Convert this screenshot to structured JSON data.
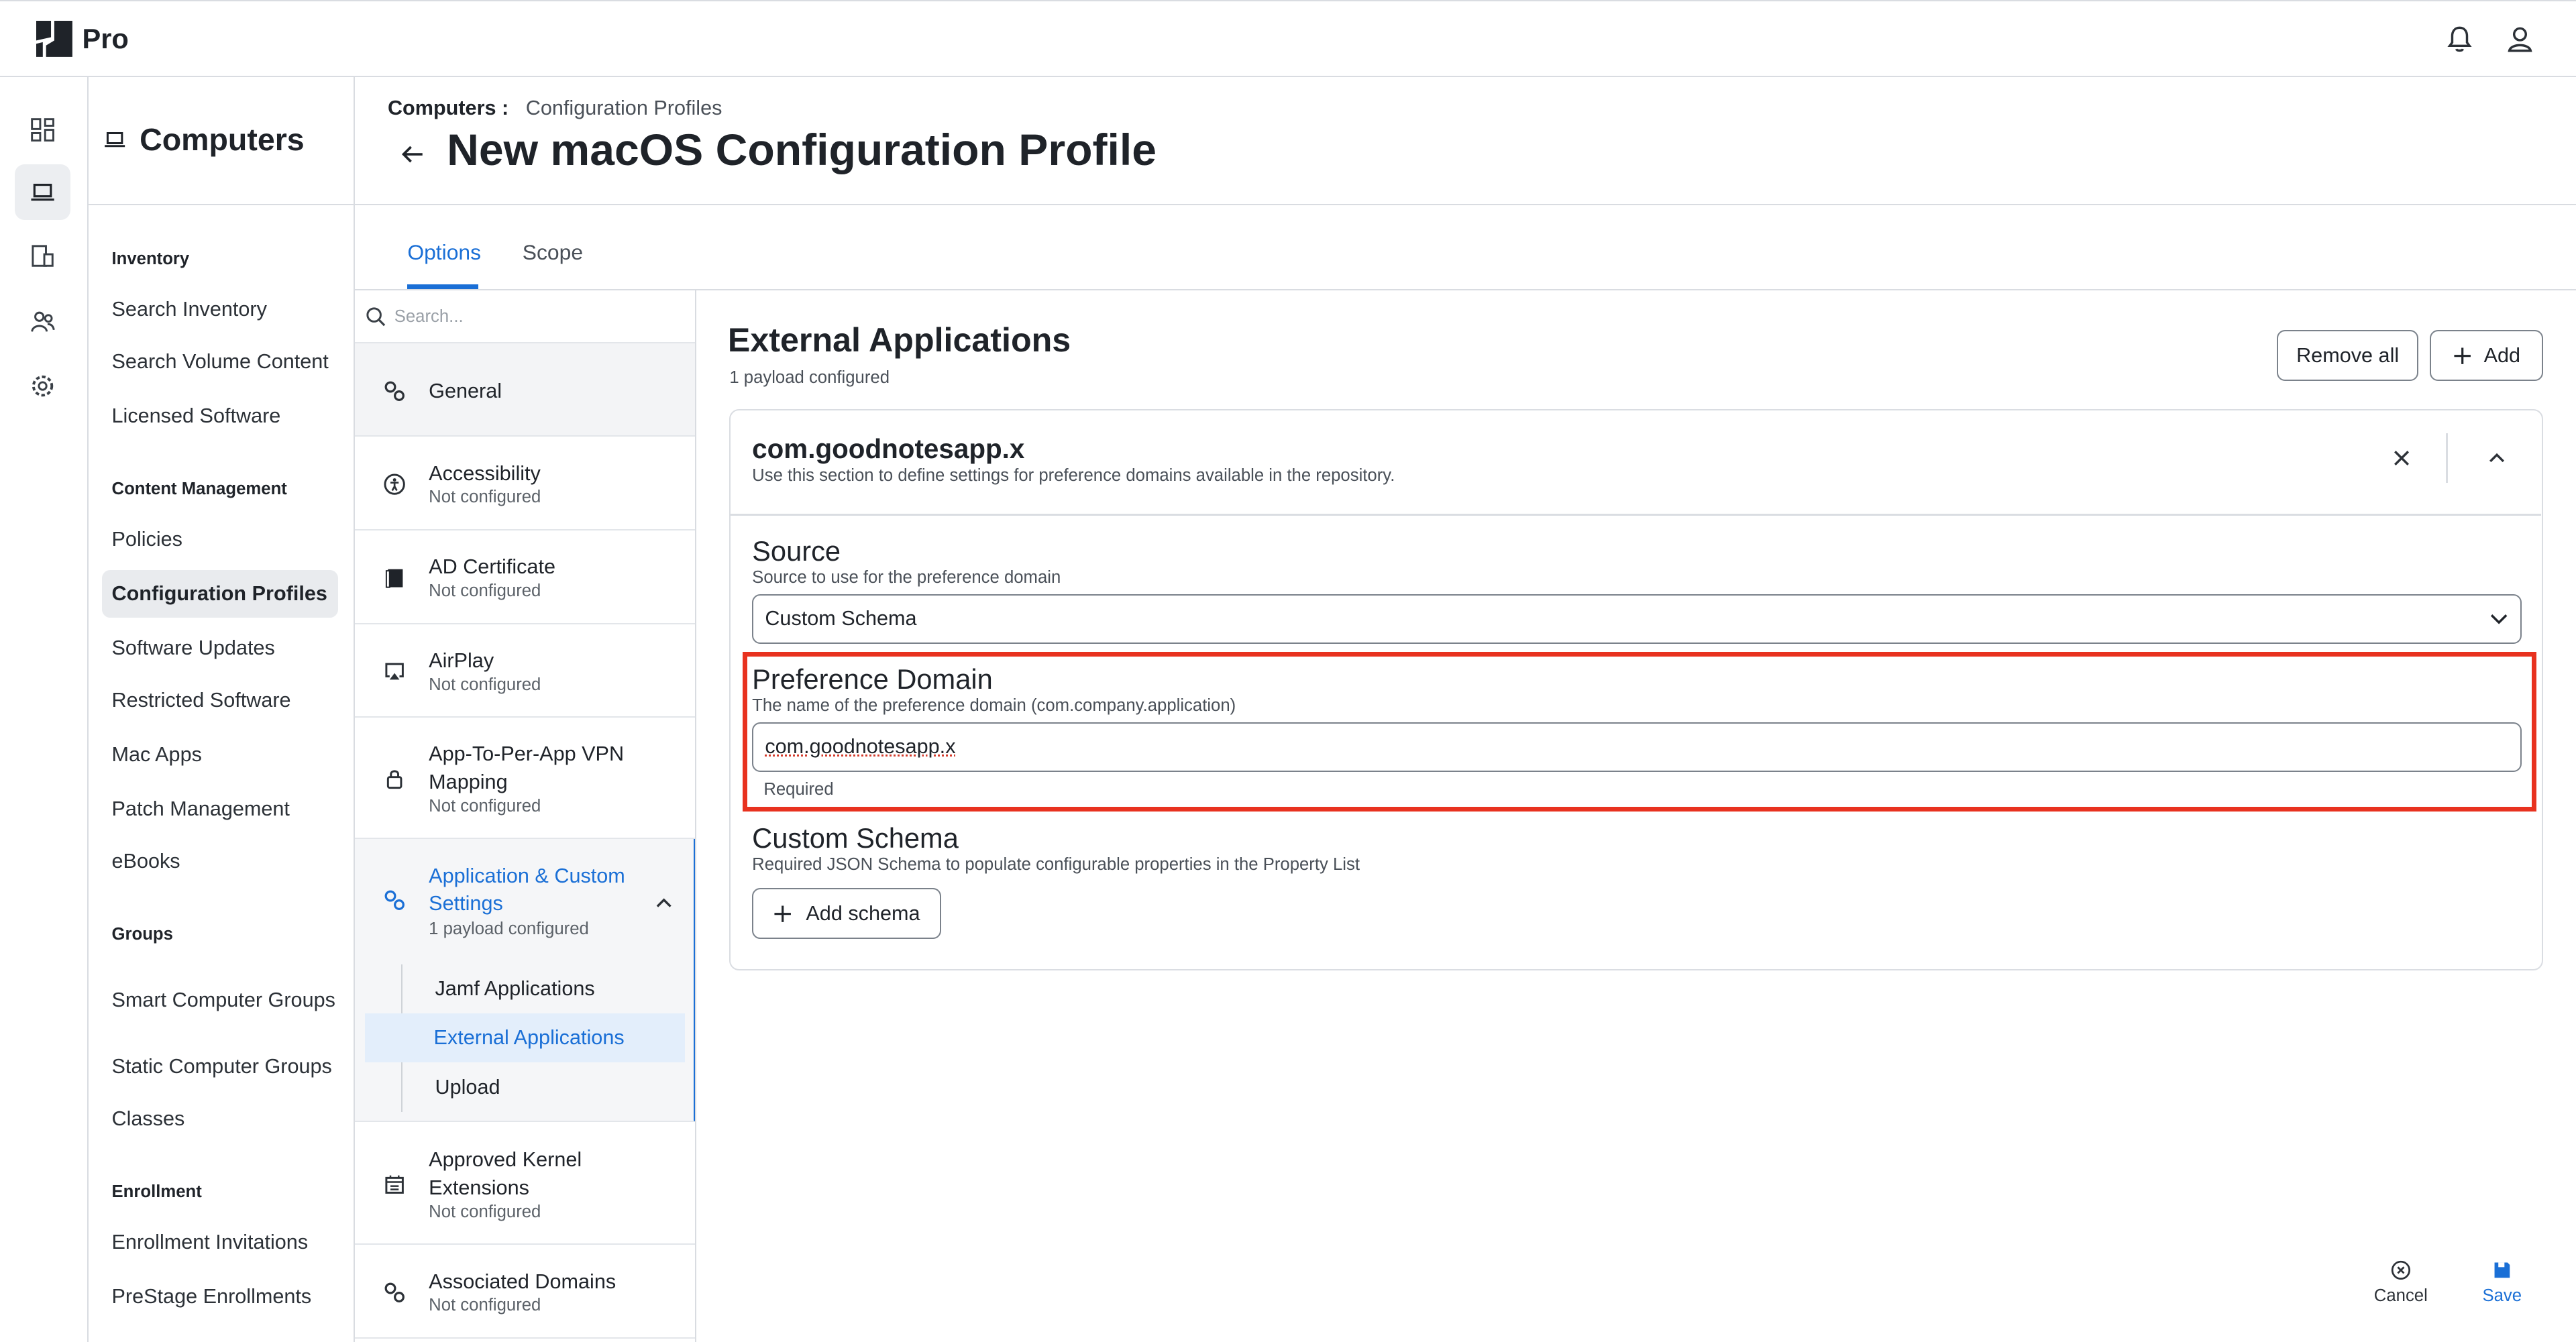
{
  "app": {
    "name": "Pro"
  },
  "nav": {
    "title": "Computers",
    "sections": [
      {
        "title": "Inventory",
        "items": [
          "Search Inventory",
          "Search Volume Content",
          "Licensed Software"
        ]
      },
      {
        "title": "Content Management",
        "items": [
          "Policies",
          "Configuration Profiles",
          "Software Updates",
          "Restricted Software",
          "Mac Apps",
          "Patch Management",
          "eBooks"
        ]
      },
      {
        "title": "Groups",
        "items": [
          "Smart Computer Groups",
          "Static Computer Groups",
          "Classes"
        ]
      },
      {
        "title": "Enrollment",
        "items": [
          "Enrollment Invitations",
          "PreStage Enrollments"
        ]
      }
    ],
    "active_item": "Configuration Profiles"
  },
  "breadcrumb": {
    "parent": "Computers",
    "separator": ":",
    "current": "Configuration Profiles"
  },
  "page_title": "New macOS Configuration Profile",
  "tabs": [
    {
      "label": "Options",
      "active": true
    },
    {
      "label": "Scope",
      "active": false
    }
  ],
  "payload_search": {
    "placeholder": "Search..."
  },
  "payloads": [
    {
      "name": "General",
      "status": "",
      "icon": "gears-icon"
    },
    {
      "name": "Accessibility",
      "status": "Not configured",
      "icon": "accessibility-icon"
    },
    {
      "name": "AD Certificate",
      "status": "Not configured",
      "icon": "certificate-icon"
    },
    {
      "name": "AirPlay",
      "status": "Not configured",
      "icon": "airplay-icon"
    },
    {
      "name": "App-To-Per-App VPN Mapping",
      "status": "Not configured",
      "icon": "lock-icon"
    },
    {
      "name": "Application & Custom Settings",
      "status": "1 payload configured",
      "icon": "gears-icon",
      "expanded": true,
      "children": [
        "Jamf Applications",
        "External Applications",
        "Upload"
      ],
      "active_child": "External Applications"
    },
    {
      "name": "Approved Kernel Extensions",
      "status": "Not configured",
      "icon": "chip-icon"
    },
    {
      "name": "Associated Domains",
      "status": "Not configured",
      "icon": "gears-icon"
    }
  ],
  "section": {
    "title": "External Applications",
    "subtitle": "1 payload configured",
    "remove_all_label": "Remove all",
    "add_label": "Add"
  },
  "payload_card": {
    "title": "com.goodnotesapp.x",
    "description": "Use this section to define settings for preference domains available in the repository.",
    "source": {
      "label": "Source",
      "help": "Source to use for the preference domain",
      "value": "Custom Schema"
    },
    "preference_domain": {
      "label": "Preference Domain",
      "help": "The name of the preference domain (com.company.application)",
      "value": "com.goodnotesapp.x",
      "note": "Required"
    },
    "custom_schema": {
      "label": "Custom Schema",
      "help": "Required JSON Schema to populate configurable properties in the Property List",
      "button_label": "Add schema"
    }
  },
  "actions": {
    "cancel_label": "Cancel",
    "save_label": "Save"
  },
  "colors": {
    "accent": "#1a6fd6",
    "highlight": "#e8321f",
    "text": "#1f2329"
  }
}
